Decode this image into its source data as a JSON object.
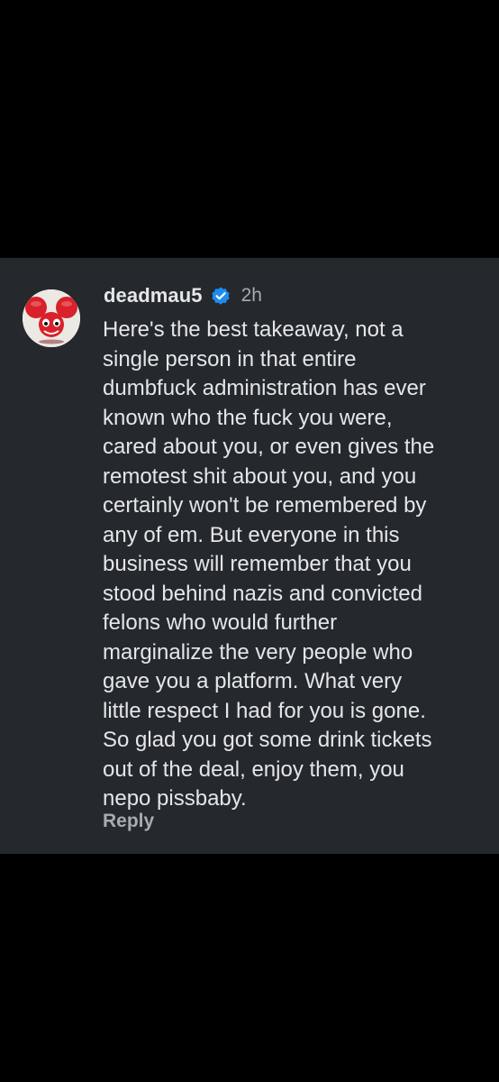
{
  "comment": {
    "username": "deadmau5",
    "verified_icon": "verified-badge-icon",
    "timestamp": "2h",
    "text": "Here's the best takeaway, not a\nsingle person in that entire\ndumbfuck administration has ever\nknown who the fuck you were,\ncared about you, or even gives the\nremotest shit about you, and you\ncertainly won't be remembered by\nany of em.  But everyone in this\nbusiness will remember that you\nstood behind nazis and convicted\nfelons who would further\nmarginalize the very people who\ngave you a platform. What very\nlittle respect I had for you is gone.\nSo glad you got some drink tickets\nout of the deal, enjoy them, you\nnepo pissbaby.",
    "reply_label": "Reply"
  },
  "colors": {
    "page_background": "#000000",
    "card_background": "#25282d",
    "primary_text": "#e4e6ea",
    "secondary_text": "#a7abb3",
    "verified_blue": "#1d8cf0",
    "avatar_red": "#d8212a"
  }
}
